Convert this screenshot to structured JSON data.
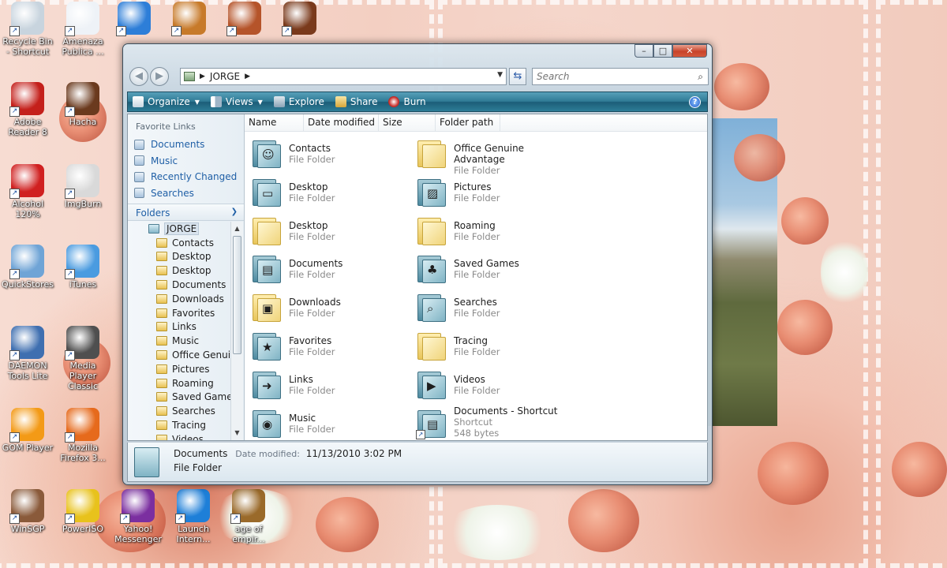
{
  "desktop": {
    "icons": [
      {
        "name": "recycle-bin-icon",
        "label": "Recycle Bin - Shortcut",
        "color": "#c8d4de"
      },
      {
        "name": "mp3-file-icon",
        "label": "Amenaza Publica ...",
        "color": "#eef2f7"
      },
      {
        "name": "quicktime-icon",
        "label": "",
        "color": "#2d7ed8"
      },
      {
        "name": "film-icon",
        "label": "",
        "color": "#c77a2a"
      },
      {
        "name": "glove-icon",
        "label": "",
        "color": "#b5542a"
      },
      {
        "name": "compass-icon",
        "label": "",
        "color": "#7a3a1c"
      },
      {
        "name": "adobe-reader-icon",
        "label": "Adobe Reader 8",
        "color": "#c4201b"
      },
      {
        "name": "hacha-icon",
        "label": "Hacha",
        "color": "#6b3a1e"
      },
      {
        "name": "alcohol-icon",
        "label": "Alcohol 120%",
        "color": "#d02020"
      },
      {
        "name": "imgburn-icon",
        "label": "ImgBurn",
        "color": "#d9d9d9"
      },
      {
        "name": "quickstores-icon",
        "label": "QuickStores",
        "color": "#6fa4d6"
      },
      {
        "name": "itunes-icon",
        "label": "iTunes",
        "color": "#4a9be0"
      },
      {
        "name": "daemon-tools-icon",
        "label": "DAEMON Tools Lite",
        "color": "#3f6fb0"
      },
      {
        "name": "media-player-classic-icon",
        "label": "Media Player Classic",
        "color": "#4f4f4f"
      },
      {
        "name": "gom-player-icon",
        "label": "GOM Player",
        "color": "#f39a16"
      },
      {
        "name": "firefox-icon",
        "label": "Mozilla Firefox 3...",
        "color": "#e66a1c"
      },
      {
        "name": "winsgp-icon",
        "label": "WinSGP",
        "color": "#8a5a3a"
      },
      {
        "name": "poweriso-icon",
        "label": "PowerISO",
        "color": "#e8c21c"
      },
      {
        "name": "yahoo-messenger-icon",
        "label": "Yahoo! Messenger",
        "color": "#7b2fa0"
      },
      {
        "name": "internet-explorer-icon",
        "label": "Launch Intern...",
        "color": "#1e7fd8"
      },
      {
        "name": "age-of-empires-icon",
        "label": "age of empir...",
        "color": "#9a6a2a"
      }
    ]
  },
  "window": {
    "address": {
      "path": "JORGE"
    },
    "search": {
      "placeholder": "Search"
    },
    "caption": {
      "minimize": "–",
      "maximize": "□",
      "close": "✕"
    },
    "toolbar": {
      "organize": "Organize",
      "views": "Views",
      "explore": "Explore",
      "share": "Share",
      "burn": "Burn",
      "help": "?"
    },
    "nav": {
      "favorites_header": "Favorite Links",
      "favorites": [
        "Documents",
        "Music",
        "Recently Changed",
        "Searches"
      ],
      "folders_header": "Folders",
      "tree_root": "JORGE",
      "tree": [
        "Contacts",
        "Desktop",
        "Desktop",
        "Documents",
        "Downloads",
        "Favorites",
        "Links",
        "Music",
        "Office Genuin",
        "Pictures",
        "Roaming",
        "Saved Games",
        "Searches",
        "Tracing",
        "Videos"
      ]
    },
    "columns": [
      "Name",
      "Date modified",
      "Size",
      "Folder path"
    ],
    "items": [
      {
        "name": "Contacts",
        "type": "File Folder",
        "icon": "contacts-folder-icon",
        "style": "teal",
        "glyph": "☺"
      },
      {
        "name": "Desktop",
        "type": "File Folder",
        "icon": "desktop-folder-icon",
        "style": "teal",
        "glyph": "▭"
      },
      {
        "name": "Desktop",
        "type": "File Folder",
        "icon": "folder-icon",
        "style": "yellow",
        "glyph": ""
      },
      {
        "name": "Documents",
        "type": "File Folder",
        "icon": "documents-folder-icon",
        "style": "teal",
        "glyph": "▤"
      },
      {
        "name": "Downloads",
        "type": "File Folder",
        "icon": "downloads-folder-icon",
        "style": "yellow",
        "glyph": "▣"
      },
      {
        "name": "Favorites",
        "type": "File Folder",
        "icon": "favorites-folder-icon",
        "style": "teal",
        "glyph": "★"
      },
      {
        "name": "Links",
        "type": "File Folder",
        "icon": "links-folder-icon",
        "style": "teal",
        "glyph": "➜"
      },
      {
        "name": "Music",
        "type": "File Folder",
        "icon": "music-folder-icon",
        "style": "teal",
        "glyph": "◉"
      },
      {
        "name": "Office Genuine Advantage",
        "type": "File Folder",
        "icon": "folder-icon",
        "style": "yellow",
        "glyph": ""
      },
      {
        "name": "Pictures",
        "type": "File Folder",
        "icon": "pictures-folder-icon",
        "style": "teal",
        "glyph": "▨"
      },
      {
        "name": "Roaming",
        "type": "File Folder",
        "icon": "folder-icon",
        "style": "yellow",
        "glyph": ""
      },
      {
        "name": "Saved Games",
        "type": "File Folder",
        "icon": "saved-games-folder-icon",
        "style": "teal",
        "glyph": "♣"
      },
      {
        "name": "Searches",
        "type": "File Folder",
        "icon": "searches-folder-icon",
        "style": "teal",
        "glyph": "⌕"
      },
      {
        "name": "Tracing",
        "type": "File Folder",
        "icon": "folder-icon",
        "style": "yellow",
        "glyph": ""
      },
      {
        "name": "Videos",
        "type": "File Folder",
        "icon": "videos-folder-icon",
        "style": "teal",
        "glyph": "▶"
      },
      {
        "name": "Documents - Shortcut",
        "type": "Shortcut",
        "extra": "548 bytes",
        "icon": "shortcut-icon",
        "style": "teal",
        "glyph": "▤"
      }
    ],
    "selected_item": "Documents",
    "details": {
      "name": "Documents",
      "date_label": "Date modified:",
      "date_value": "11/13/2010 3:02 PM",
      "type": "File Folder"
    }
  }
}
